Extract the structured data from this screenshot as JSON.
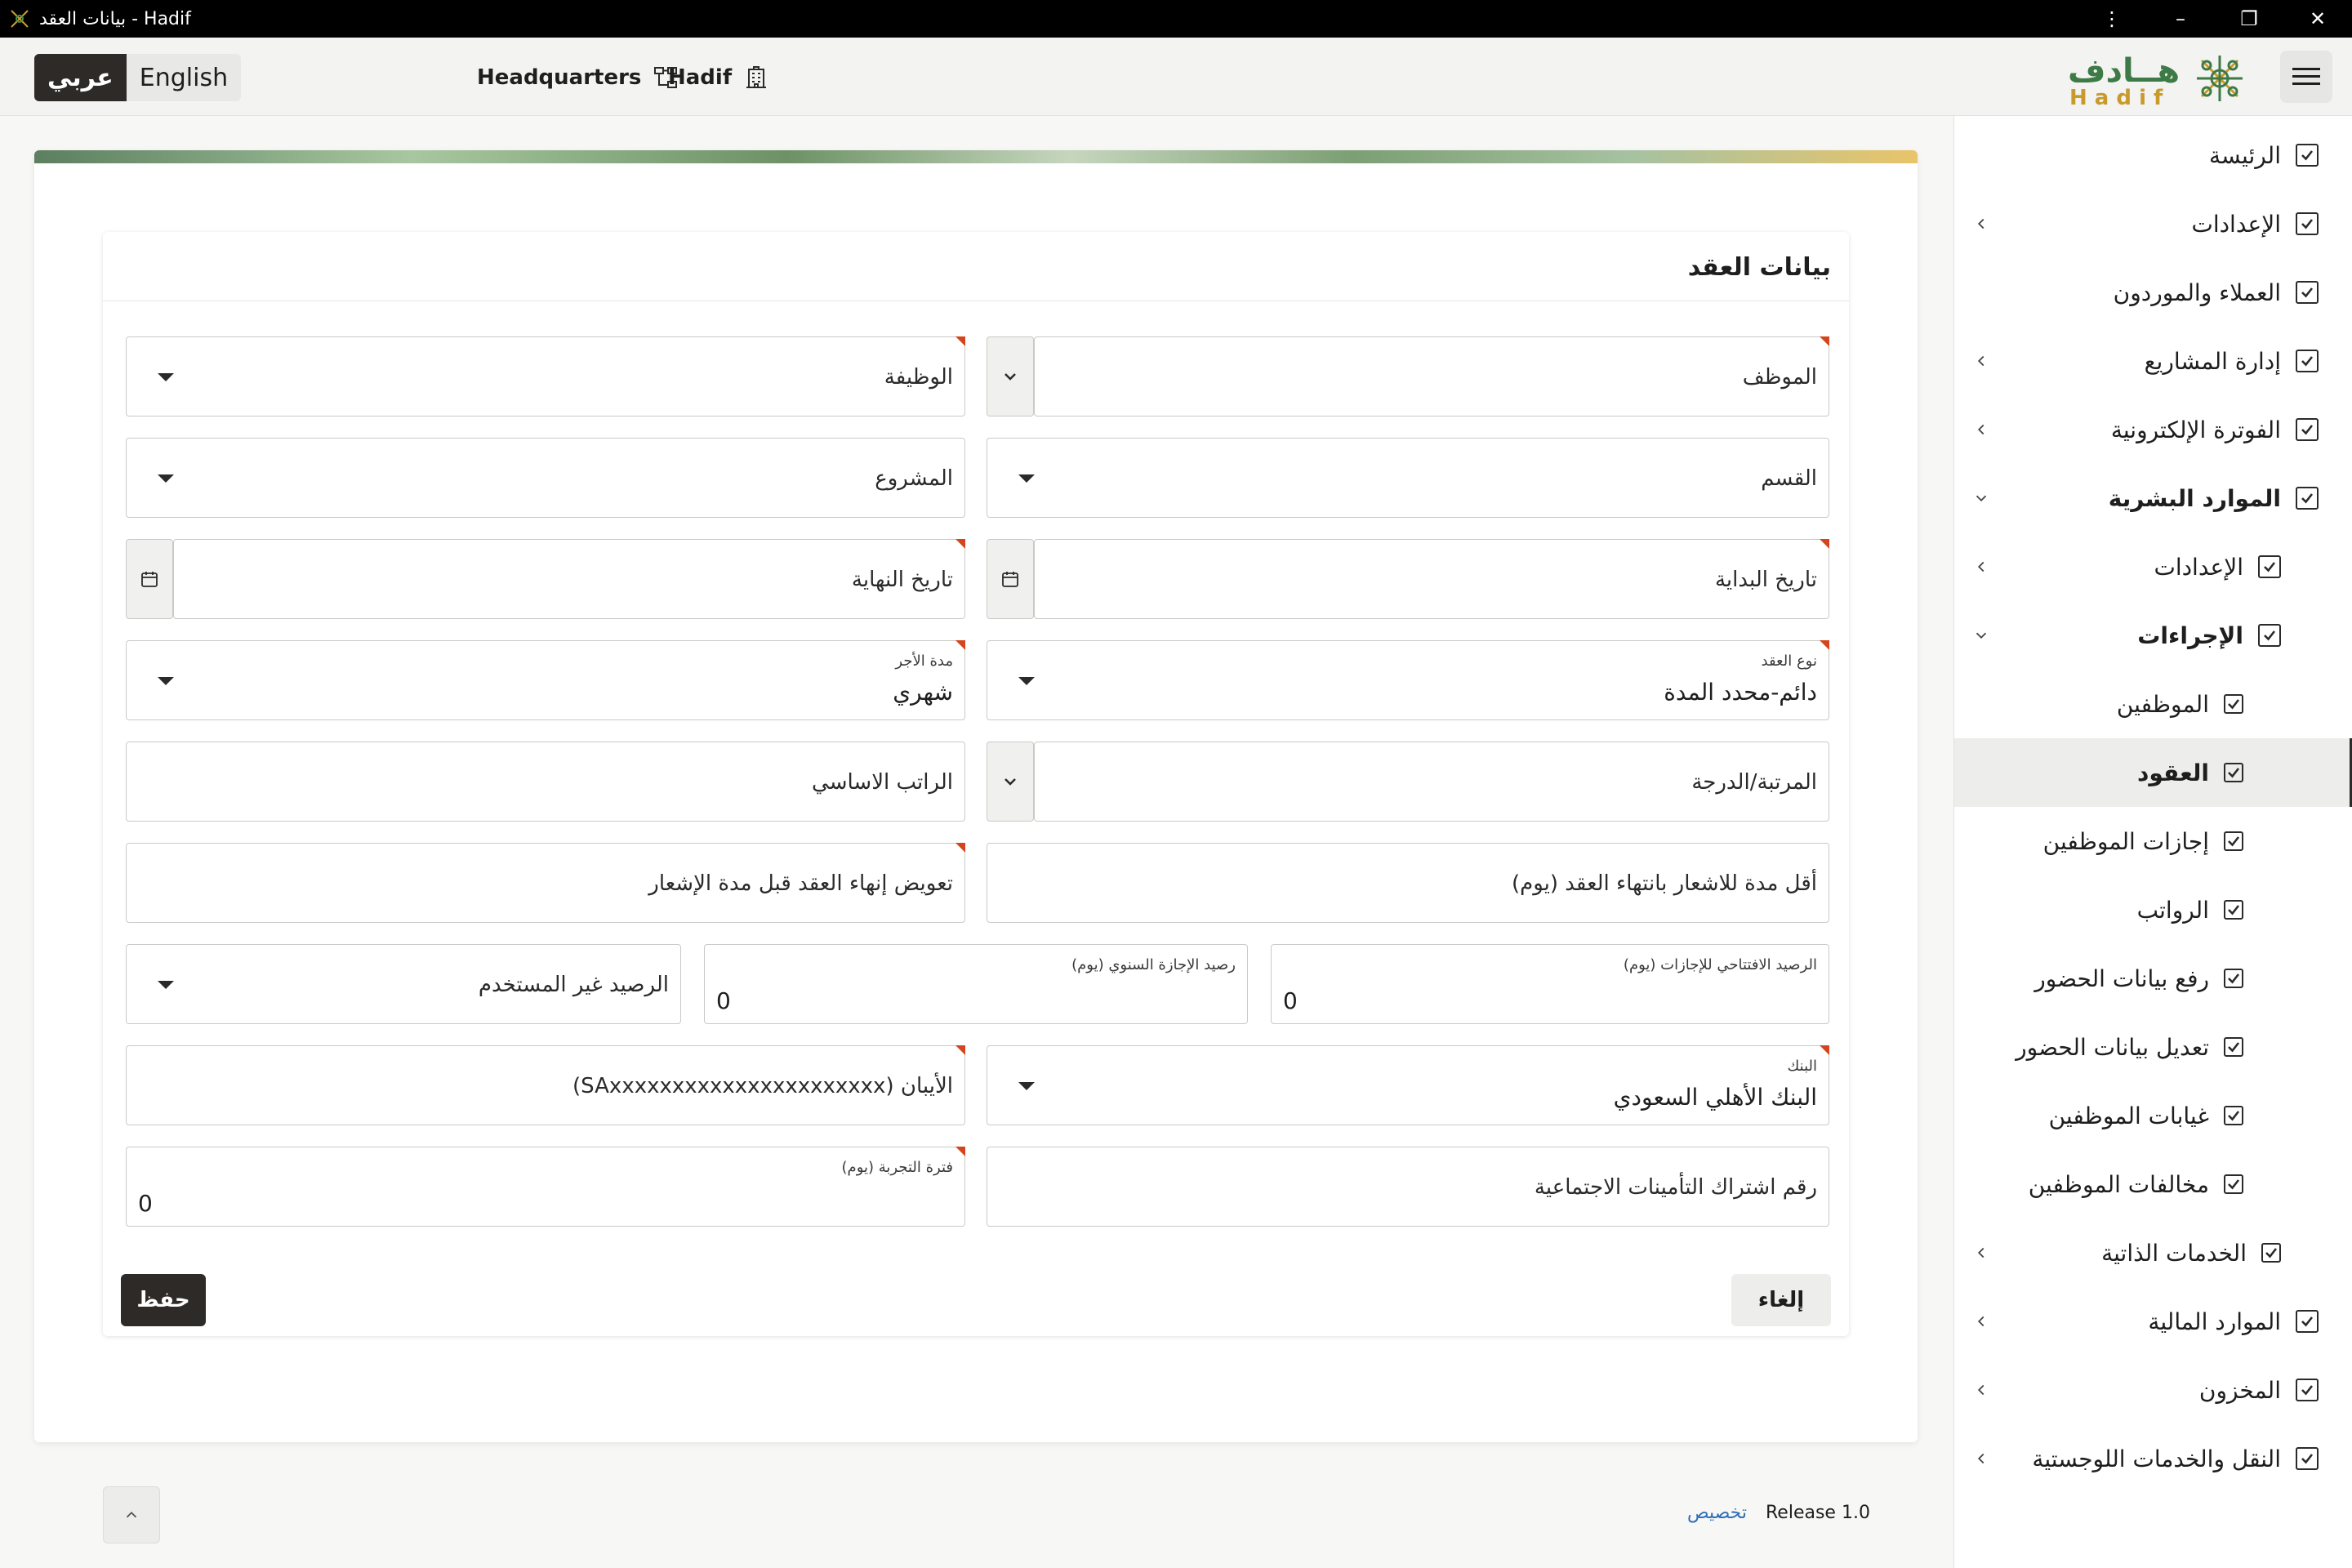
{
  "window": {
    "title": "بيانات العقد - Hadif",
    "menu_icon": "more-vertical-icon",
    "min_icon": "minimize-icon",
    "restore_icon": "restore-icon",
    "close_icon": "close-icon"
  },
  "header": {
    "lang_ar": "عربي",
    "lang_en": "English",
    "branch": "Headquarters",
    "company": "Hadif",
    "logo_ar": "هــادف",
    "logo_en": "H a d i f"
  },
  "sidebar": {
    "items": [
      {
        "label": "الرئيسة",
        "chevron": false
      },
      {
        "label": "الإعدادات",
        "chevron": "left"
      },
      {
        "label": "العملاء والموردون",
        "chevron": false
      },
      {
        "label": "إدارة المشاريع",
        "chevron": "left"
      },
      {
        "label": "الفوترة الإلكترونية",
        "chevron": "left"
      },
      {
        "label": "الموارد البشرية",
        "chevron": "down"
      },
      {
        "label": "الإعدادات",
        "chevron": "left"
      },
      {
        "label": "الإجراءات",
        "chevron": "down"
      },
      {
        "label": "الموظفين",
        "chevron": false
      },
      {
        "label": "العقود",
        "chevron": false
      },
      {
        "label": "إجازات الموظفين",
        "chevron": false
      },
      {
        "label": "الرواتب",
        "chevron": false
      },
      {
        "label": "رفع بيانات الحضور",
        "chevron": false
      },
      {
        "label": "تعديل بيانات الحضور",
        "chevron": false
      },
      {
        "label": "غيابات الموظفين",
        "chevron": false
      },
      {
        "label": "مخالفات الموظفين",
        "chevron": false
      },
      {
        "label": "الخدمات الذاتية",
        "chevron": "left"
      },
      {
        "label": "الموارد المالية",
        "chevron": "left"
      },
      {
        "label": "المخزون",
        "chevron": "left"
      },
      {
        "label": "النقل والخدمات اللوجستية",
        "chevron": "left"
      }
    ]
  },
  "form": {
    "title": "بيانات العقد",
    "employee": "الموظف",
    "job": "الوظيفة",
    "department": "القسم",
    "project": "المشروع",
    "start_date": "تاريخ البداية",
    "end_date": "تاريخ النهاية",
    "contract_type_label": "نوع العقد",
    "contract_type_value": "دائم-محدد المدة",
    "wage_period_label": "مدة الأجر",
    "wage_period_value": "شهري",
    "grade": "المرتبة/الدرجة",
    "basic_salary": "الراتب الاساسي",
    "min_notice": "أقل مدة للاشعار بانتهاء العقد (يوم)",
    "termination_comp": "تعويض إنهاء العقد قبل مدة الإشعار",
    "opening_balance_label": "الرصيد الافتتاحي للإجازات (يوم)",
    "opening_balance_value": "0",
    "annual_balance_label": "رصيد الإجازة السنوي (يوم)",
    "annual_balance_value": "0",
    "unused_balance": "الرصيد غير المستخدم",
    "bank_label": "البنك",
    "bank_value": "البنك الأهلي السعودي",
    "iban": "الأيبان (SAxxxxxxxxxxxxxxxxxxxxxx)",
    "gosi": "رقم اشتراك التأمينات الاجتماعية",
    "probation_label": "فترة التجربة (يوم)",
    "probation_value": "0",
    "save": "حفظ",
    "cancel": "إلغاء"
  },
  "footer": {
    "release": "Release 1.0",
    "customize": "تخصيص"
  }
}
